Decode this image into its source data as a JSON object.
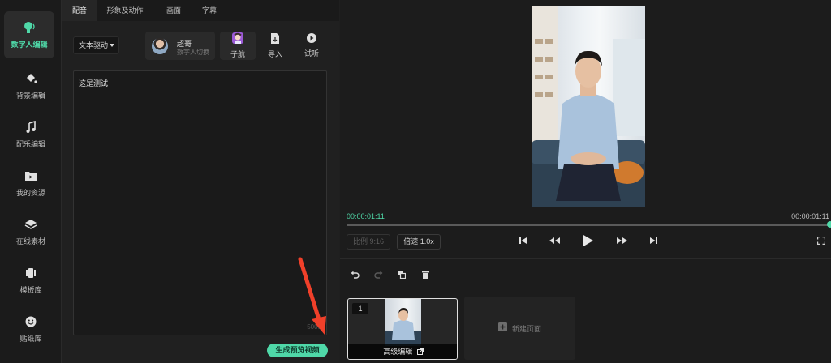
{
  "sidebar": {
    "items": [
      {
        "label": "数字人编辑",
        "icon": "digital-human-icon",
        "active": true
      },
      {
        "label": "背景编辑",
        "icon": "paint-bucket-icon"
      },
      {
        "label": "配乐编辑",
        "icon": "music-note-icon"
      },
      {
        "label": "我的资源",
        "icon": "folder-icon"
      },
      {
        "label": "在线素材",
        "icon": "layers-icon"
      },
      {
        "label": "模板库",
        "icon": "template-icon"
      },
      {
        "label": "贴纸库",
        "icon": "sticker-icon"
      }
    ]
  },
  "tabs": [
    "配音",
    "形象及动作",
    "画面",
    "字幕"
  ],
  "editor": {
    "mode": "文本驱动",
    "avatar_name": "超哥",
    "avatar_sub": "数字人切换",
    "voice_label": "子航",
    "import_label": "导入",
    "listen_label": "试听",
    "text": "这是测试",
    "char_limit": "5000",
    "generate_label": "生成预览视频"
  },
  "player": {
    "time_current": "00:00:01:11",
    "time_total": "00:00:01:11",
    "progress": 1.0,
    "ratio_label": "比例 9:16",
    "speed_label": "倍速 1.0x"
  },
  "timeline": {
    "page_number": "1",
    "advanced_edit_label": "高级编辑",
    "new_page_label": "新建页面"
  },
  "colors": {
    "accent": "#4fd8a8",
    "annotation_arrow": "#f0402a"
  }
}
